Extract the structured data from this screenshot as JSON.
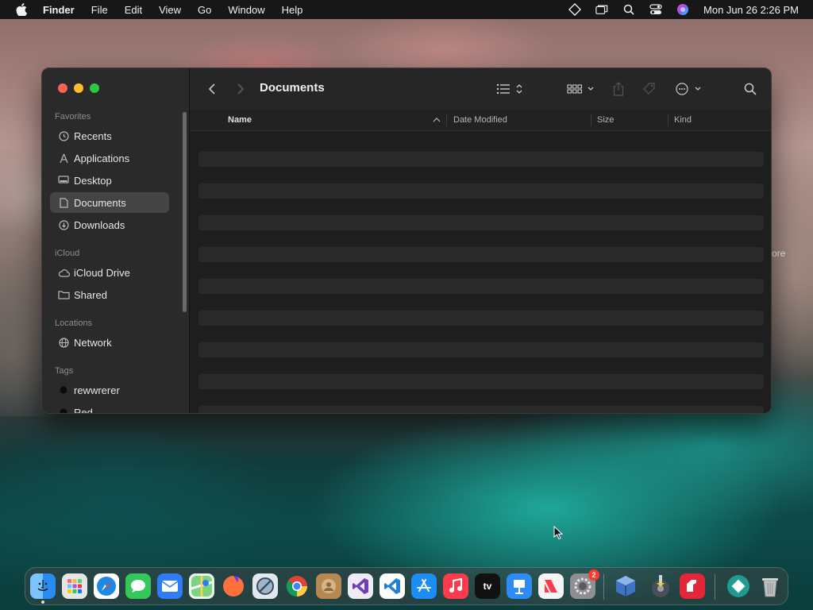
{
  "menubar": {
    "app_name": "Finder",
    "menus": [
      "File",
      "Edit",
      "View",
      "Go",
      "Window",
      "Help"
    ],
    "clock": "Mon Jun 26  2:26 PM",
    "status_icons": [
      "diamond-icon",
      "windows-icon",
      "spotlight-search-icon",
      "control-center-icon",
      "siri-icon"
    ]
  },
  "window": {
    "title": "Documents",
    "sidebar": {
      "favorites_label": "Favorites",
      "favorites": [
        {
          "label": "Recents",
          "icon": "clock-icon"
        },
        {
          "label": "Applications",
          "icon": "applications-icon"
        },
        {
          "label": "Desktop",
          "icon": "desktop-icon"
        },
        {
          "label": "Documents",
          "icon": "document-icon",
          "selected": true
        },
        {
          "label": "Downloads",
          "icon": "download-icon"
        }
      ],
      "icloud_label": "iCloud",
      "icloud": [
        {
          "label": "iCloud Drive",
          "icon": "cloud-icon"
        },
        {
          "label": "Shared",
          "icon": "shared-folder-icon"
        }
      ],
      "locations_label": "Locations",
      "locations": [
        {
          "label": "Network",
          "icon": "globe-icon"
        }
      ],
      "tags_label": "Tags",
      "tags": [
        {
          "label": "rewwrerer",
          "color": "#111111"
        },
        {
          "label": "Red",
          "color": "#111111"
        }
      ]
    },
    "columns": {
      "name": "Name",
      "date_modified": "Date Modified",
      "size": "Size",
      "kind": "Kind"
    }
  },
  "desktop": {
    "partial_label": "ore"
  },
  "dock": {
    "apps": [
      {
        "name": "Finder",
        "icon": "finder-icon",
        "color": "#2a8cf0",
        "running": true
      },
      {
        "name": "Launchpad",
        "icon": "launchpad-icon",
        "color": "#d9d9d9"
      },
      {
        "name": "Safari",
        "icon": "safari-icon",
        "color": "#1e88e5"
      },
      {
        "name": "Messages",
        "icon": "messages-icon",
        "color": "#34c759"
      },
      {
        "name": "Mail",
        "icon": "mail-icon",
        "color": "#2f7cf6"
      },
      {
        "name": "Maps",
        "icon": "maps-icon",
        "color": "#4caf50"
      },
      {
        "name": "Firefox",
        "icon": "firefox-icon",
        "color": "#ff7139"
      },
      {
        "name": "No Access",
        "icon": "blocked-icon",
        "color": "#cfd8e0"
      },
      {
        "name": "Chrome",
        "icon": "chrome-icon",
        "color": "#e8e8e8"
      },
      {
        "name": "Contacts",
        "icon": "contacts-icon",
        "color": "#b58a52"
      },
      {
        "name": "Visual Studio",
        "icon": "visual-studio-icon",
        "color": "#6c3fb5"
      },
      {
        "name": "VS Code",
        "icon": "vscode-icon",
        "color": "#1f80d6"
      },
      {
        "name": "App Store",
        "icon": "app-store-icon",
        "color": "#1b8df3"
      },
      {
        "name": "Music",
        "icon": "music-icon",
        "color": "#fa3c4c"
      },
      {
        "name": "TV",
        "icon": "apple-tv-icon",
        "color": "#111111",
        "label": "tv"
      },
      {
        "name": "Keynote",
        "icon": "keynote-icon",
        "color": "#2f8cf6"
      },
      {
        "name": "News",
        "icon": "news-icon",
        "color": "#f5f5f5"
      },
      {
        "name": "System Settings",
        "icon": "settings-icon",
        "color": "#8e8e93",
        "badge": "2"
      },
      {
        "name": "VirtualBox",
        "icon": "virtualbox-icon",
        "color": "#1c5aa6"
      },
      {
        "name": "Disk Utility",
        "icon": "disk-utility-icon",
        "color": "#3b3b3b"
      },
      {
        "name": "Parallels",
        "icon": "parallels-icon",
        "color": "#e3263a"
      },
      {
        "name": "Migration",
        "icon": "diamond-app-icon",
        "color": "#1f9b8f"
      },
      {
        "name": "Trash",
        "icon": "trash-icon",
        "color": "#bfbfbf"
      }
    ]
  }
}
